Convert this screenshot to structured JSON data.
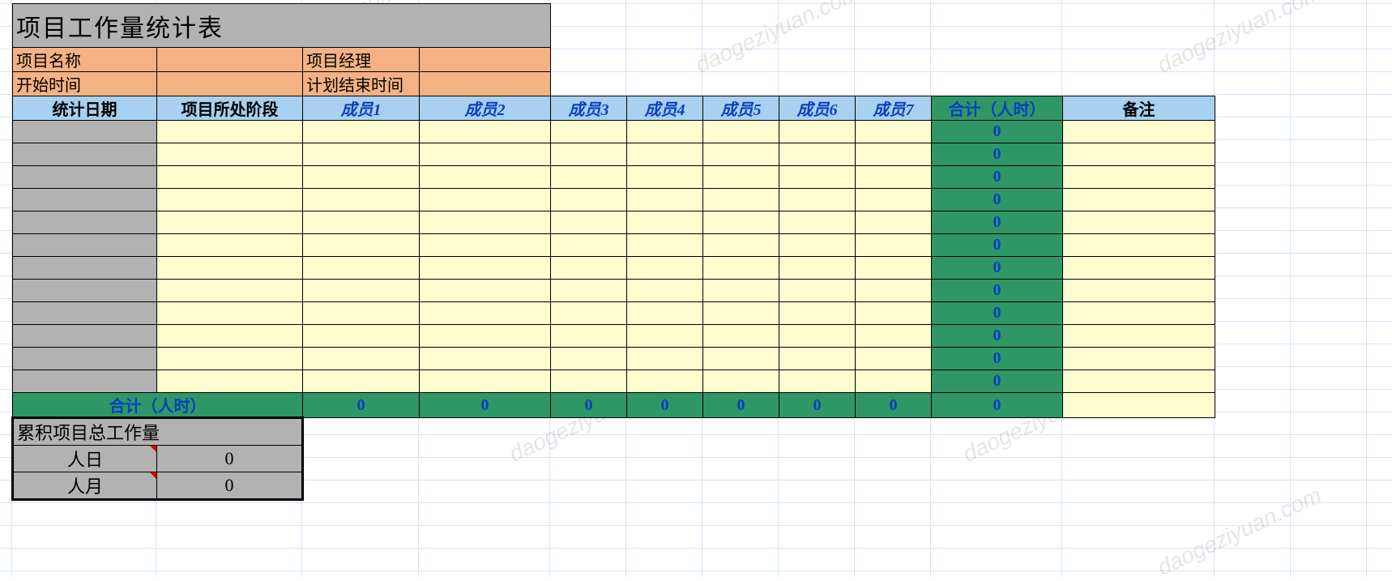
{
  "title": "项目工作量统计表",
  "info": {
    "proj_name_label": "项目名称",
    "proj_name_value": "",
    "pm_label": "项目经理",
    "pm_value": "",
    "start_label": "开始时间",
    "start_value": "",
    "end_label": "计划结束时间",
    "end_value": ""
  },
  "headers": {
    "date": "统计日期",
    "phase": "项目所处阶段",
    "m1": "成员1",
    "m2": "成员2",
    "m3": "成员3",
    "m4": "成员4",
    "m5": "成员5",
    "m6": "成员6",
    "m7": "成员7",
    "total": "合计（人时）",
    "remark": "备注"
  },
  "row_totals": [
    "0",
    "0",
    "0",
    "0",
    "0",
    "0",
    "0",
    "0",
    "0",
    "0",
    "0",
    "0"
  ],
  "footer": {
    "label": "合计（人时）",
    "m1": "0",
    "m2": "0",
    "m3": "0",
    "m4": "0",
    "m5": "0",
    "m6": "0",
    "m7": "0",
    "total": "0"
  },
  "summary": {
    "title": "累积项目总工作量",
    "r1_label": "人日",
    "r1_value": "0",
    "r2_label": "人月",
    "r2_value": "0"
  },
  "watermark": "daogeziyuan.com",
  "chart_data": {
    "type": "table",
    "title": "项目工作量统计表",
    "columns": [
      "统计日期",
      "项目所处阶段",
      "成员1",
      "成员2",
      "成员3",
      "成员4",
      "成员5",
      "成员6",
      "成员7",
      "合计（人时）",
      "备注"
    ],
    "rows": [
      [
        "",
        "",
        "",
        "",
        "",
        "",
        "",
        "",
        "",
        "0",
        ""
      ],
      [
        "",
        "",
        "",
        "",
        "",
        "",
        "",
        "",
        "",
        "0",
        ""
      ],
      [
        "",
        "",
        "",
        "",
        "",
        "",
        "",
        "",
        "",
        "0",
        ""
      ],
      [
        "",
        "",
        "",
        "",
        "",
        "",
        "",
        "",
        "",
        "0",
        ""
      ],
      [
        "",
        "",
        "",
        "",
        "",
        "",
        "",
        "",
        "",
        "0",
        ""
      ],
      [
        "",
        "",
        "",
        "",
        "",
        "",
        "",
        "",
        "",
        "0",
        ""
      ],
      [
        "",
        "",
        "",
        "",
        "",
        "",
        "",
        "",
        "",
        "0",
        ""
      ],
      [
        "",
        "",
        "",
        "",
        "",
        "",
        "",
        "",
        "",
        "0",
        ""
      ],
      [
        "",
        "",
        "",
        "",
        "",
        "",
        "",
        "",
        "",
        "0",
        ""
      ],
      [
        "",
        "",
        "",
        "",
        "",
        "",
        "",
        "",
        "",
        "0",
        ""
      ],
      [
        "",
        "",
        "",
        "",
        "",
        "",
        "",
        "",
        "",
        "0",
        ""
      ],
      [
        "",
        "",
        "",
        "",
        "",
        "",
        "",
        "",
        "",
        "0",
        ""
      ]
    ],
    "footer_row": [
      "合计（人时）",
      "",
      "0",
      "0",
      "0",
      "0",
      "0",
      "0",
      "0",
      "0",
      ""
    ],
    "summary": {
      "累积项目总工作量": {
        "人日": 0,
        "人月": 0
      }
    }
  }
}
